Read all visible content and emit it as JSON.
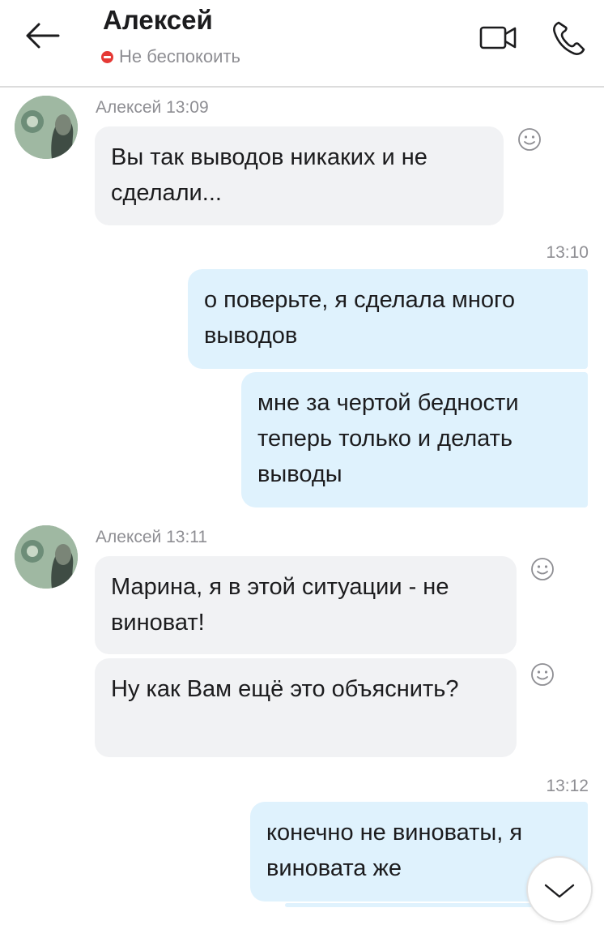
{
  "header": {
    "title": "Алексей",
    "status": "Не беспокоить"
  },
  "messages": [
    {
      "meta": "Алексей 13:09",
      "text": "Вы так выводов никаких и не сделали..."
    },
    {
      "time": "13:10",
      "text": "о поверьте, я сделала много выводов"
    },
    {
      "text": "мне за чертой бедности теперь только и делать выводы"
    },
    {
      "meta": "Алексей 13:11",
      "text": "Марина, я в этой ситуации - не виноват!"
    },
    {
      "text": "Ну как Вам ещё это объяснить?"
    },
    {
      "time": "13:12",
      "text": "конечно не виноваты, я виновата же"
    }
  ],
  "colors": {
    "incoming_bubble": "#f1f2f4",
    "outgoing_bubble": "#dff2fd",
    "status_dnd": "#e53935"
  }
}
